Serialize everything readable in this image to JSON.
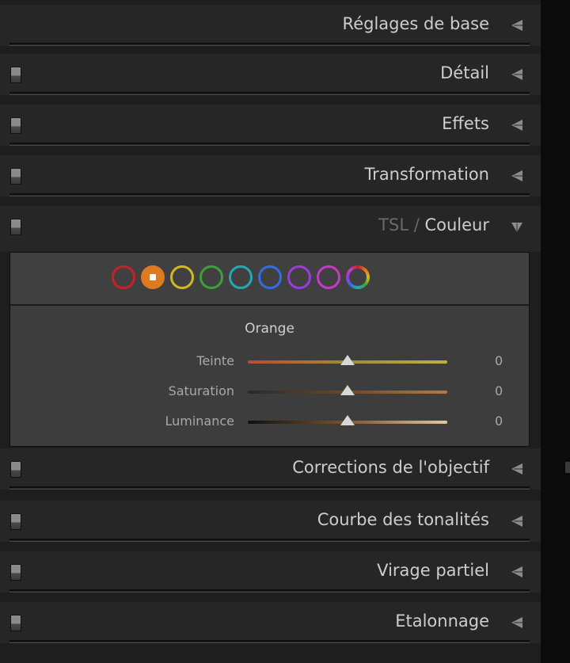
{
  "panels": [
    {
      "label": "Réglages de base",
      "has_switch": false,
      "expanded": false
    },
    {
      "label": "Détail",
      "has_switch": true,
      "expanded": false
    },
    {
      "label": "Effets",
      "has_switch": true,
      "expanded": false
    },
    {
      "label": "Transformation",
      "has_switch": true,
      "expanded": false
    },
    {
      "label_dim": "TSL / ",
      "label": "Couleur",
      "has_switch": true,
      "expanded": true
    },
    {
      "label": "Corrections de l'objectif",
      "has_switch": true,
      "expanded": false
    },
    {
      "label": "Courbe des tonalités",
      "has_switch": true,
      "expanded": false
    },
    {
      "label": "Virage partiel",
      "has_switch": true,
      "expanded": false
    },
    {
      "label": "Etalonnage",
      "has_switch": true,
      "expanded": false
    }
  ],
  "color_swatches": [
    {
      "name": "red",
      "color": "#c8202a",
      "selected": false
    },
    {
      "name": "orange",
      "color": "#e07a20",
      "selected": true
    },
    {
      "name": "yellow",
      "color": "#d6b81e",
      "selected": false
    },
    {
      "name": "green",
      "color": "#3ea03a",
      "selected": false
    },
    {
      "name": "aqua",
      "color": "#22a9b4",
      "selected": false
    },
    {
      "name": "blue",
      "color": "#2f6fe0",
      "selected": false
    },
    {
      "name": "purple",
      "color": "#9b3bd9",
      "selected": false
    },
    {
      "name": "magenta",
      "color": "#c43ac9",
      "selected": false
    },
    {
      "name": "all",
      "color": "multicolor",
      "selected": false
    }
  ],
  "selected_color_label": "Orange",
  "sliders": [
    {
      "label": "Teinte",
      "value": "0",
      "level": 0.5,
      "gradient": [
        "#b84a3a",
        "#a08a3a",
        "#b9b23e"
      ]
    },
    {
      "label": "Saturation",
      "value": "0",
      "level": 0.5,
      "gradient": [
        "#2a2a2a",
        "#6a4a2a",
        "#b87a3a"
      ]
    },
    {
      "label": "Luminance",
      "value": "0",
      "level": 0.5,
      "gradient": [
        "#101010",
        "#7a5530",
        "#e0c9a0"
      ]
    }
  ]
}
